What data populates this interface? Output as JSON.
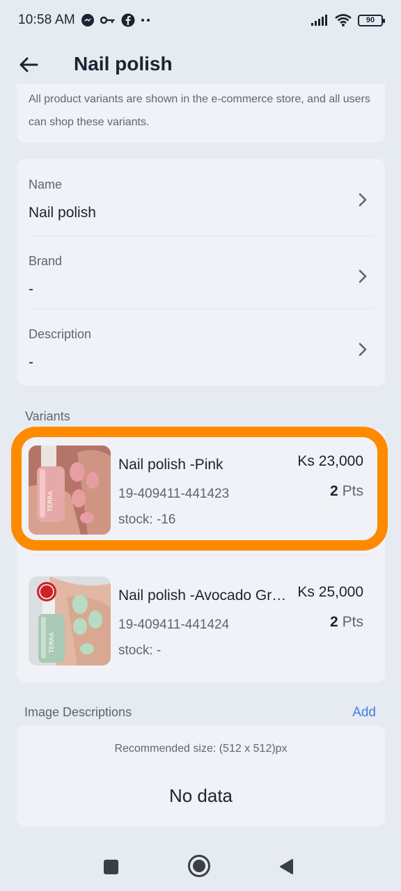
{
  "status_bar": {
    "time": "10:58 AM",
    "left_icons": [
      "messenger-icon",
      "key-icon",
      "facebook-icon",
      "more-dots-icon"
    ],
    "right_icons": [
      "signal-icon",
      "wifi-icon",
      "battery-icon"
    ],
    "battery_level": "90"
  },
  "header": {
    "back_icon": "back-arrow-icon",
    "title": "Nail polish"
  },
  "info": {
    "text": "All product variants are shown in the e-commerce store, and all users can shop these variants."
  },
  "fields": [
    {
      "label": "Name",
      "value": "Nail polish"
    },
    {
      "label": "Brand",
      "value": "-"
    },
    {
      "label": "Description",
      "value": "-"
    }
  ],
  "variants": {
    "label": "Variants",
    "items": [
      {
        "name": "Nail polish -Pink",
        "sku": "19-409411-441423",
        "stock": "stock: -16",
        "price": "Ks 23,000",
        "points": "2",
        "points_unit": "Pts"
      },
      {
        "name": "Nail polish -Avocado Green",
        "sku": "19-409411-441424",
        "stock": "stock: -",
        "price": "Ks 25,000",
        "points": "2",
        "points_unit": "Pts"
      }
    ]
  },
  "image_descriptions": {
    "label": "Image Descriptions",
    "add_label": "Add",
    "recommended": "Recommended size: (512 x 512)px",
    "empty": "No data"
  },
  "colors": {
    "highlight": "#ff8a00",
    "accent": "#3f7fe0",
    "background": "#e6eaf1",
    "card": "#f0f2f7"
  }
}
